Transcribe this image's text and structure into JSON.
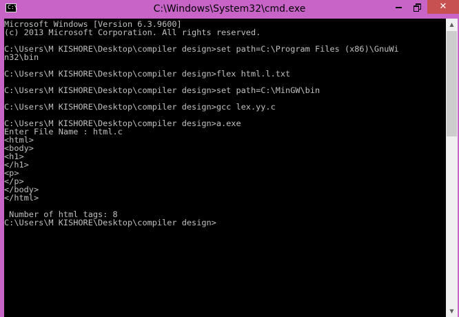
{
  "window": {
    "title": "C:\\Windows\\System32\\cmd.exe",
    "icon": "cmd-icon",
    "icon_glyph": "C:\\",
    "controls": {
      "minimize_icon": "minimize-icon",
      "maximize_icon": "restore-icon",
      "close_icon": "close-icon",
      "close_glyph": "✕"
    },
    "colors": {
      "frame": "#c864c8",
      "console_bg": "#000000",
      "console_fg": "#c0c0c0",
      "close_button": "#c75050"
    }
  },
  "console": {
    "lines": [
      "Microsoft Windows [Version 6.3.9600]",
      "(c) 2013 Microsoft Corporation. All rights reserved.",
      "",
      "C:\\Users\\M KISHORE\\Desktop\\compiler design>set path=C:\\Program Files (x86)\\GnuWi",
      "n32\\bin",
      "",
      "C:\\Users\\M KISHORE\\Desktop\\compiler design>flex html.l.txt",
      "",
      "C:\\Users\\M KISHORE\\Desktop\\compiler design>set path=C:\\MinGW\\bin",
      "",
      "C:\\Users\\M KISHORE\\Desktop\\compiler design>gcc lex.yy.c",
      "",
      "C:\\Users\\M KISHORE\\Desktop\\compiler design>a.exe",
      "Enter File Name : html.c",
      "<html>",
      "<body>",
      "<h1>",
      "</h1>",
      "<p>",
      "</p>",
      "</body>",
      "</html>",
      "",
      " Number of html tags: 8",
      "C:\\Users\\M KISHORE\\Desktop\\compiler design>"
    ]
  },
  "scrollbar": {
    "up_arrow": "▲",
    "down_arrow": "▼",
    "up_icon": "scroll-up-arrow-icon",
    "down_icon": "scroll-down-arrow-icon"
  }
}
